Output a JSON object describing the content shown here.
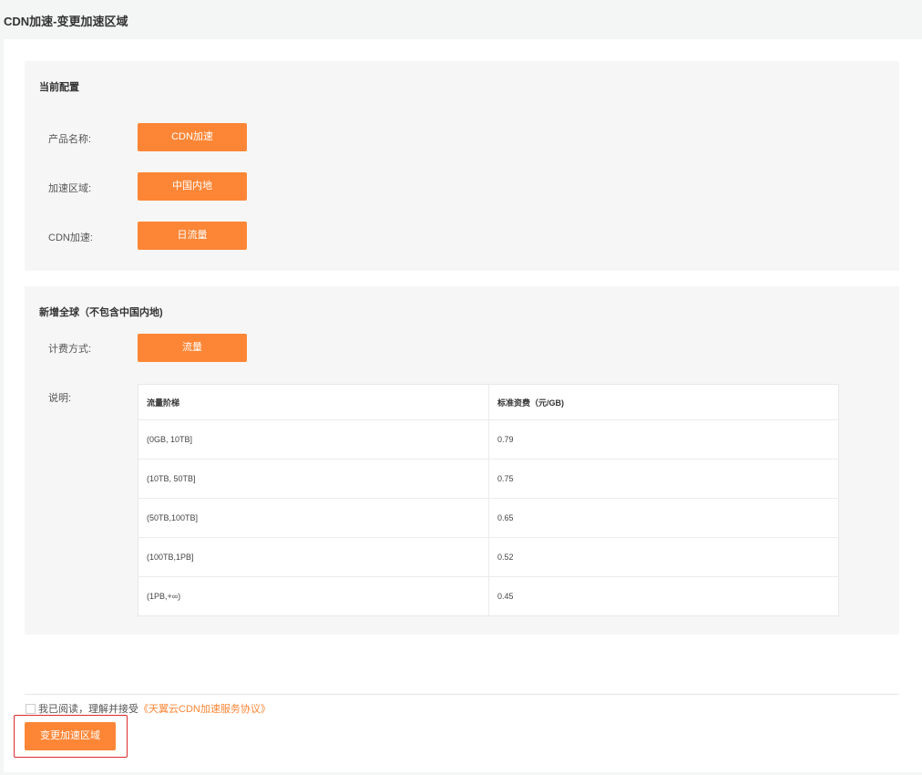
{
  "page": {
    "title": "CDN加速-变更加速区域"
  },
  "current_config": {
    "title": "当前配置",
    "rows": [
      {
        "label": "产品名称:",
        "value": "CDN加速"
      },
      {
        "label": "加速区域:",
        "value": "中国内地"
      },
      {
        "label": "CDN加速:",
        "value": "日流量"
      }
    ]
  },
  "global_section": {
    "title": "新增全球（不包含中国内地)",
    "billing_label": "计费方式:",
    "billing_value": "流量",
    "desc_label": "说明:",
    "table": {
      "headers": [
        "流量阶梯",
        "标准资费（元/GB)"
      ],
      "rows": [
        [
          "(0GB, 10TB]",
          "0.79"
        ],
        [
          "(10TB, 50TB]",
          "0.75"
        ],
        [
          "(50TB,100TB]",
          "0.65"
        ],
        [
          "(100TB,1PB]",
          "0.52"
        ],
        [
          "(1PB,+∞)",
          "0.45"
        ]
      ]
    }
  },
  "agreement": {
    "text": "我已阅读，理解并接受",
    "link_text": "《天翼云CDN加速服务协议》",
    "checked": false
  },
  "submit": {
    "label": "变更加速区域"
  },
  "colors": {
    "accent": "#fd8636",
    "highlight_border": "#e02a2a"
  }
}
